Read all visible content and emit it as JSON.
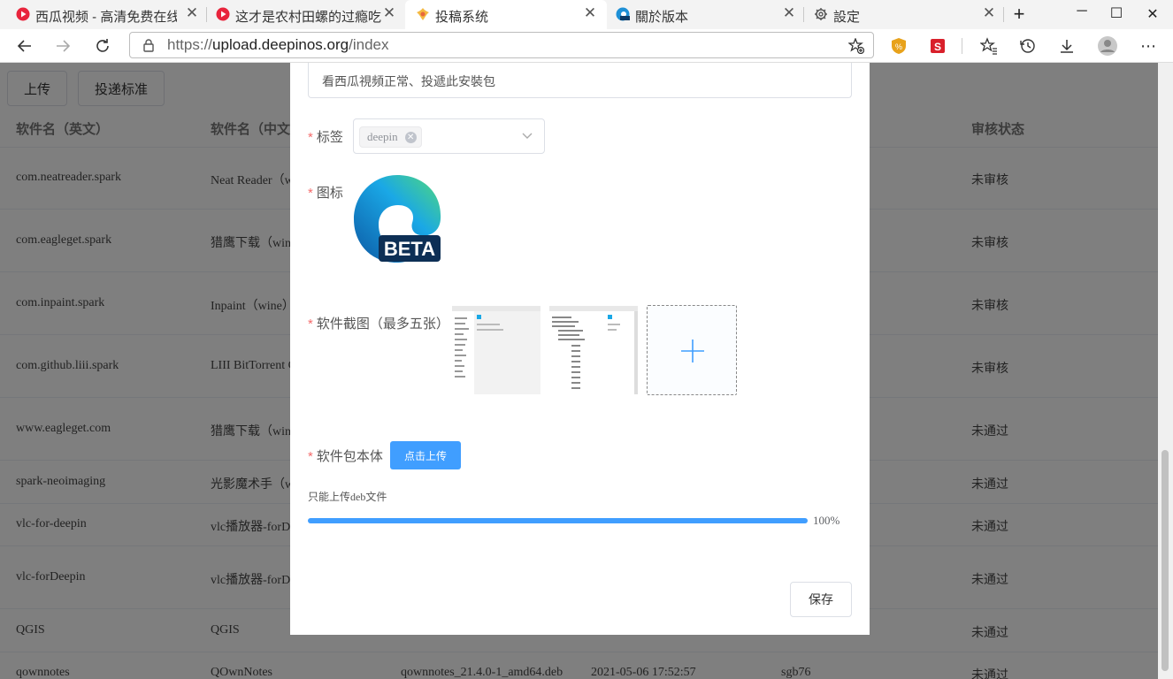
{
  "browser": {
    "tabs": [
      {
        "title": "西瓜视频 - 高清免费在线视",
        "icon": "xigua-icon"
      },
      {
        "title": "这才是农村田螺的过瘾吃法",
        "icon": "xigua-icon"
      },
      {
        "title": "投稿系统",
        "icon": "spark-icon",
        "active": true
      },
      {
        "title": "關於版本",
        "icon": "edge-beta-icon"
      },
      {
        "title": "設定",
        "icon": "gear-icon"
      }
    ],
    "url_prefix": "https://",
    "url_host": "upload.deepinos.org",
    "url_path": "/index"
  },
  "page": {
    "buttons": {
      "upload": "上传",
      "standard": "投递标准"
    },
    "columns": {
      "name_en": "软件名（英文）",
      "name_cn": "软件名（中文）",
      "status": "审核状态"
    },
    "rows": [
      {
        "en": "com.neatreader.spark",
        "cn": "Neat Reader（wine）",
        "status": "未审核"
      },
      {
        "en": "com.eagleget.spark",
        "cn": "猎鹰下载（wine）",
        "status": "未审核"
      },
      {
        "en": "com.inpaint.spark",
        "cn": "Inpaint（wine）",
        "status": "未审核"
      },
      {
        "en": "com.github.liii.spark",
        "cn": "LIII BitTorrent Client",
        "status": "未审核"
      },
      {
        "en": "www.eagleget.com",
        "cn": "猎鹰下载（wine）",
        "status": "未通过"
      },
      {
        "en": "spark-neoimaging",
        "cn": "光影魔术手（wine）",
        "status": "未通过"
      },
      {
        "en": "vlc-for-deepin",
        "cn": "vlc播放器-forDeepin",
        "status": "未通过"
      },
      {
        "en": "vlc-forDeepin",
        "cn": "vlc播放器-forDeepin",
        "status": "未通过"
      },
      {
        "en": "QGIS",
        "cn": "QGIS",
        "status": "未通过"
      },
      {
        "en": "qownnotes",
        "cn": "QOwnNotes",
        "file": "qownnotes_21.4.0-1_amd64.deb",
        "date": "2021-05-06 17:52:57",
        "user": "sgb76",
        "status": "未通过"
      }
    ]
  },
  "dialog": {
    "description_value": "看西瓜視頻正常、投遞此安裝包",
    "required_mark": "*",
    "tag_label": "标签",
    "tag_chip": "deepin",
    "icon_label": "图标",
    "icon_text": "BETA",
    "screenshots_label": "软件截图（最多五张）",
    "package_label": "软件包本体",
    "upload_button": "点击上传",
    "upload_tip": "只能上传deb文件",
    "progress_text": "100%",
    "progress": 1.0,
    "save_button": "保存"
  }
}
